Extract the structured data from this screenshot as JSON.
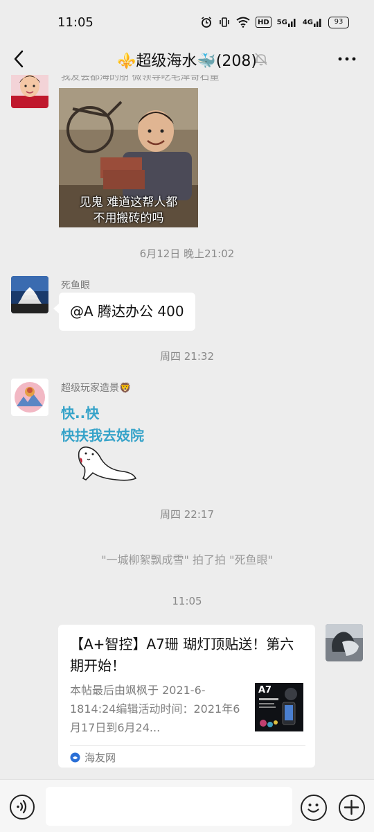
{
  "status": {
    "time": "11:05",
    "hd": "HD",
    "signal1": "5G",
    "signal2": "4G",
    "battery": "93"
  },
  "header": {
    "title": "⚜️超级海水🐳(208)",
    "icons": [
      "back-arrow-icon",
      "mute-bell-icon",
      "more-icon"
    ]
  },
  "messages": {
    "partial_top_sender": "我友会都海的朋 微领导吃毛泽哥石量",
    "meme_caption_line1": "见鬼 难道这帮人都",
    "meme_caption_line2": "不用搬砖的吗",
    "ts1": "6月12日 晚上21:02",
    "msg2_sender": "死鱼眼",
    "msg2_text": "@A 腾达办公 400",
    "ts2": "周四 21:32",
    "msg3_sender": "超级玩家造景🦁",
    "msg3_line1": "快..快",
    "msg3_line2": "快扶我去妓院",
    "ts3": "周四 22:17",
    "pat_notice": "\"一城柳絮飘成雪\" 拍了拍 \"死鱼眼\"",
    "ts4": "11:05",
    "link_title": "【A+智控】A7珊 瑚灯顶贴送！第六期开始！",
    "link_desc": "本帖最后由飒枫于 2021-6-1814:24编辑活动时间：2021年6月17日到6月24...",
    "link_thumb_text": "A7",
    "link_source": "海友网"
  },
  "colors": {
    "background": "#ededed",
    "bubble": "#ffffff",
    "teal_text": "#36a3c9",
    "timestamp": "#8a8a8a"
  }
}
